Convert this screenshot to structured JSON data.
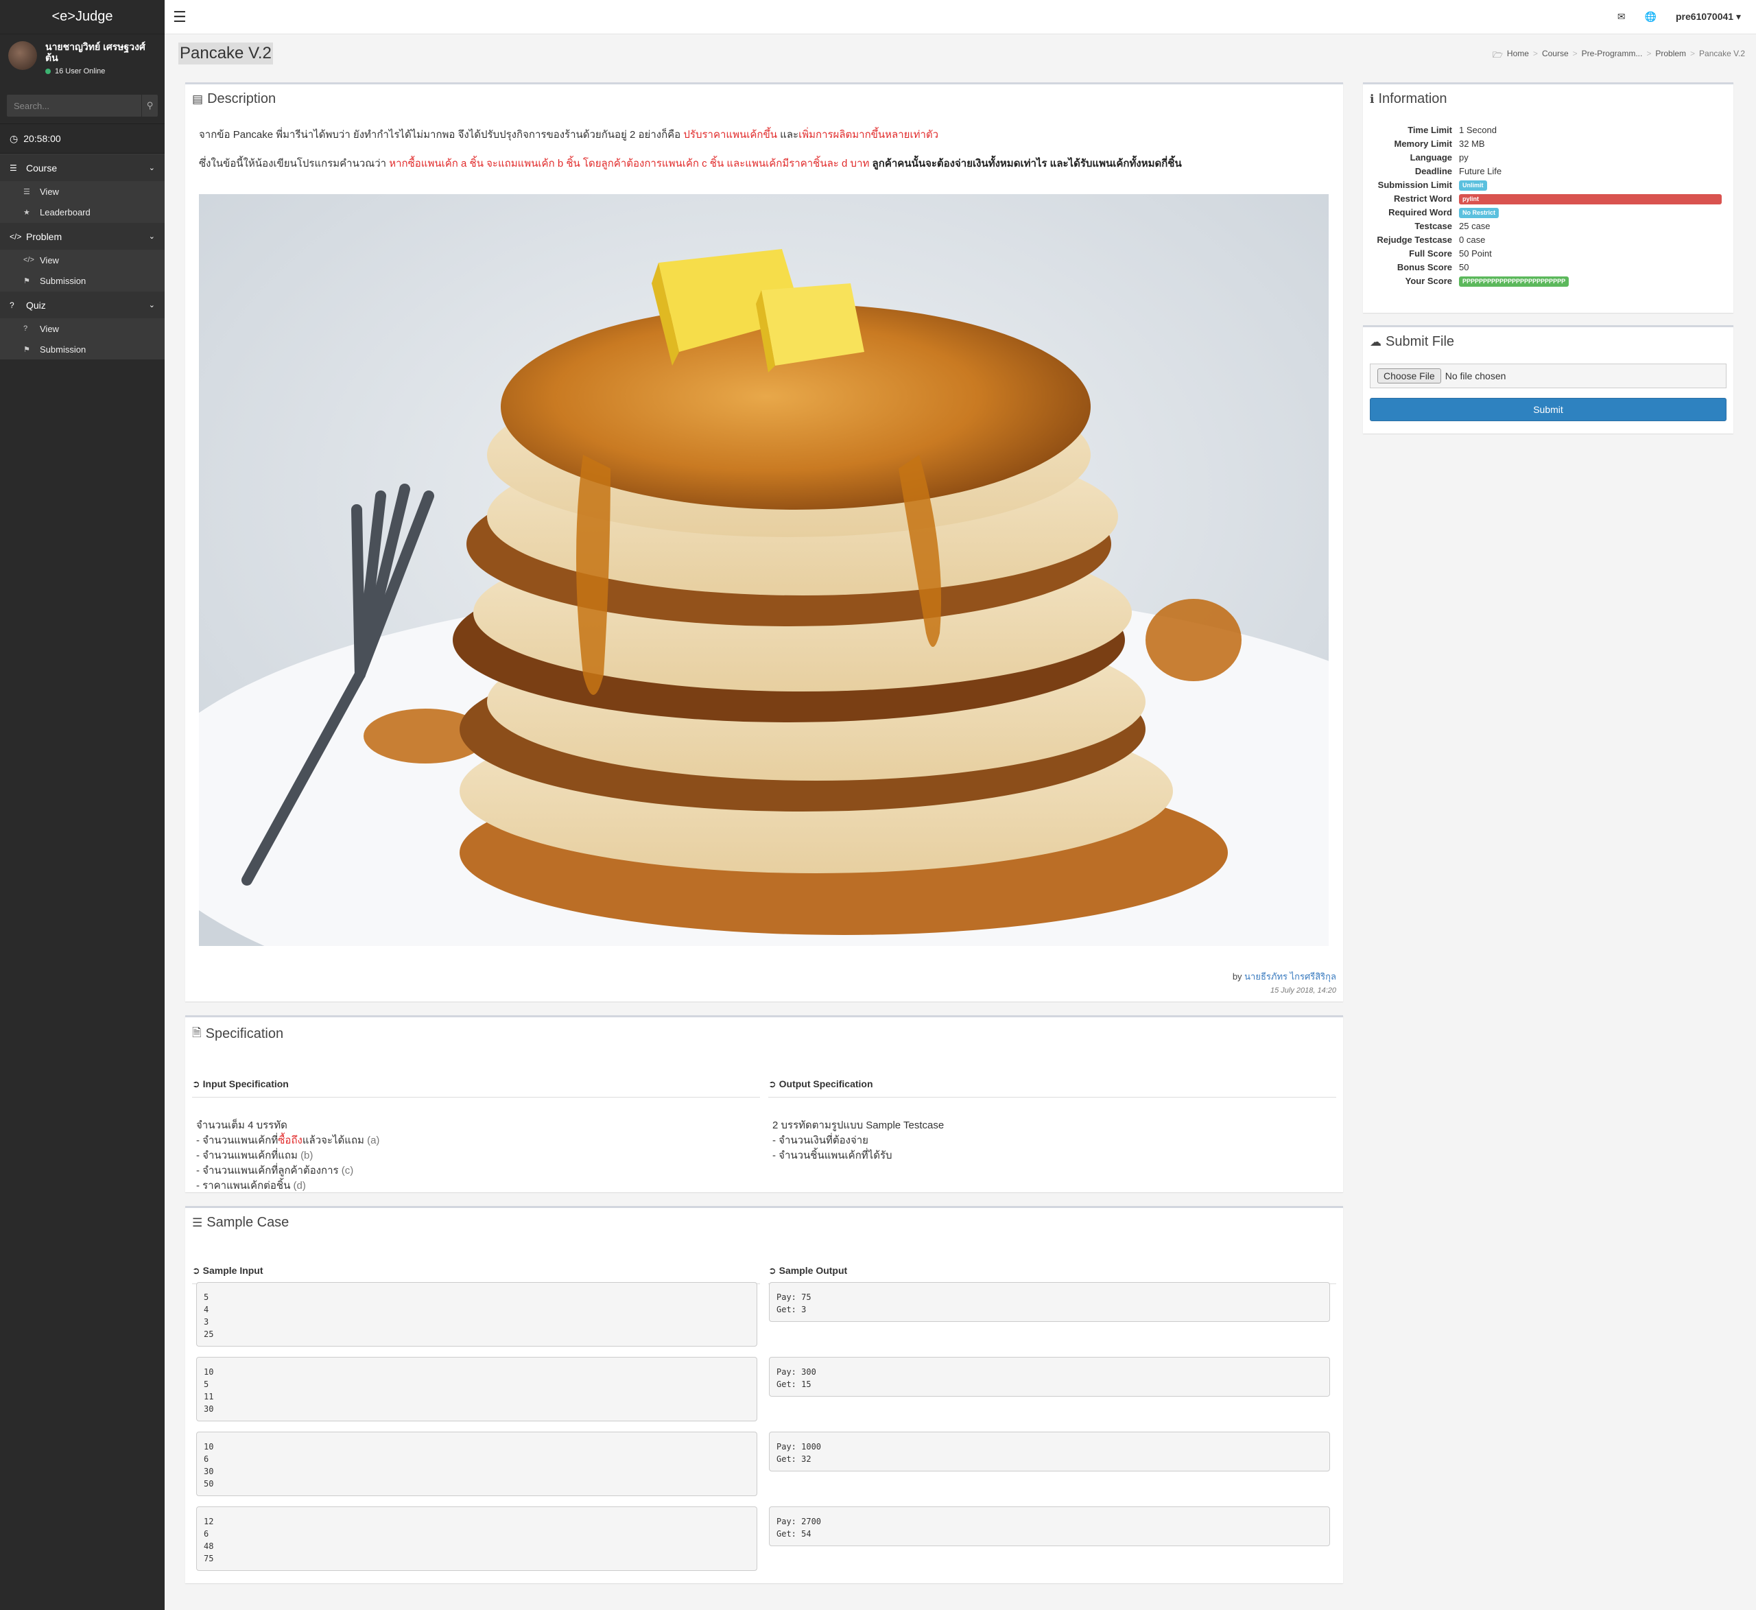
{
  "app": {
    "brand": "<e>Judge"
  },
  "profile": {
    "name": "นายชาญวิทย์ เศรษฐวงศ์ต้น",
    "online": "16 User Online"
  },
  "search": {
    "placeholder": "Search..."
  },
  "clock": "20:58:00",
  "sidebar": {
    "groups": [
      {
        "label": "Course",
        "items": [
          {
            "label": "View"
          },
          {
            "label": "Leaderboard"
          }
        ]
      },
      {
        "label": "Problem",
        "items": [
          {
            "label": "View"
          },
          {
            "label": "Submission"
          }
        ]
      },
      {
        "label": "Quiz",
        "items": [
          {
            "label": "View"
          },
          {
            "label": "Submission"
          }
        ]
      }
    ]
  },
  "topbar": {
    "user": "pre61070041"
  },
  "page": {
    "title": "Pancake V.2"
  },
  "breadcrumb": [
    "Home",
    "Course",
    "Pre-Programm...",
    "Problem",
    "Pancake V.2"
  ],
  "description": {
    "title": "Description",
    "p1_a": "จากข้อ Pancake พี่มารีน่าได้พบว่า ยังทำกำไรได้ไม่มากพอ จึงได้ปรับปรุงกิจการของร้านด้วยกันอยู่ 2 อย่างก็คือ ",
    "p1_b": "ปรับราคาแพนเค้กขึ้น",
    "p1_c": " และ",
    "p1_d": "เพิ่มการผลิตมากขึ้นหลายเท่าตัว",
    "p2_a": "ซึ่งในข้อนี้ให้น้องเขียนโปรแกรมคำนวณว่า ",
    "p2_b": "หากซื้อแพนเค้ก a ชิ้น จะแถมแพนเค้ก b ชิ้น โดยลูกค้าต้องการแพนเค้ก c ชิ้น และแพนเค้กมีราคาชิ้นละ d บาท",
    "p2_c": " ลูกค้าคนนั้นจะต้องจ่ายเงินทั้งหมดเท่าไร และได้รับแพนเค้กทั้งหมดกี่ชิ้น",
    "by": "by ",
    "author": "นายธีรภัทร ไกรศรีสิริกุล",
    "date": "15 July 2018, 14:20"
  },
  "specification": {
    "title": "Specification",
    "input_head": "Input Specification",
    "output_head": "Output Specification",
    "input_lines": {
      "l0": "จำนวนเต็ม 4 บรรทัด",
      "l1_a": "- จำนวนแพนเค้กที่",
      "l1_b": "ซื้อถึง",
      "l1_c": "แล้วจะได้แถม ",
      "l1_d": "(a)",
      "l2_a": "- จำนวนแพนเค้กที่แถม ",
      "l2_b": "(b)",
      "l3_a": "- จำนวนแพนเค้กที่ลูกค้าต้องการ ",
      "l3_b": "(c)",
      "l4_a": "- ราคาแพนเค้กต่อชิ้น ",
      "l4_b": "(d)"
    },
    "output_lines": {
      "l0": "2 บรรทัดตามรูปแบบ Sample Testcase",
      "l1": "- จำนวนเงินที่ต้องจ่าย",
      "l2": "- จำนวนชิ้นแพนเค้กที่ได้รับ"
    }
  },
  "samples": {
    "title": "Sample Case",
    "input_head": "Sample Input",
    "output_head": "Sample Output",
    "cases": [
      {
        "input": "5\n4\n3\n25",
        "output": "Pay: 75\nGet: 3"
      },
      {
        "input": "10\n5\n11\n30",
        "output": "Pay: 300\nGet: 15"
      },
      {
        "input": "10\n6\n30\n50",
        "output": "Pay: 1000\nGet: 32"
      },
      {
        "input": "12\n6\n48\n75",
        "output": "Pay: 2700\nGet: 54"
      }
    ]
  },
  "information": {
    "title": "Information",
    "rows": [
      {
        "label": "Time Limit",
        "value": "1 Second"
      },
      {
        "label": "Memory Limit",
        "value": "32 MB"
      },
      {
        "label": "Language",
        "value": "py"
      },
      {
        "label": "Deadline",
        "value": "Future Life"
      },
      {
        "label": "Submission Limit",
        "value": "Unlimit"
      },
      {
        "label": "Restrict Word",
        "value": "pylint"
      },
      {
        "label": "Required Word",
        "value": "No Restrict"
      },
      {
        "label": "Testcase",
        "value": "25 case"
      },
      {
        "label": "Rejudge Testcase",
        "value": "0 case"
      },
      {
        "label": "Full Score",
        "value": "50 Point"
      },
      {
        "label": "Bonus Score",
        "value": "50"
      },
      {
        "label": "Your Score",
        "value": "PPPPPPPPPPPPPPPPPPPPPPPPP"
      }
    ]
  },
  "submit": {
    "title": "Submit File",
    "choose": "Choose File",
    "no_file": "No file chosen",
    "button": "Submit"
  },
  "colors": {
    "accent": "#2e82c0",
    "sidebar": "#2a2a2a",
    "red_text": "#e12b2b",
    "success": "#5cb85c",
    "info": "#5bc0de",
    "danger": "#d9534f"
  }
}
